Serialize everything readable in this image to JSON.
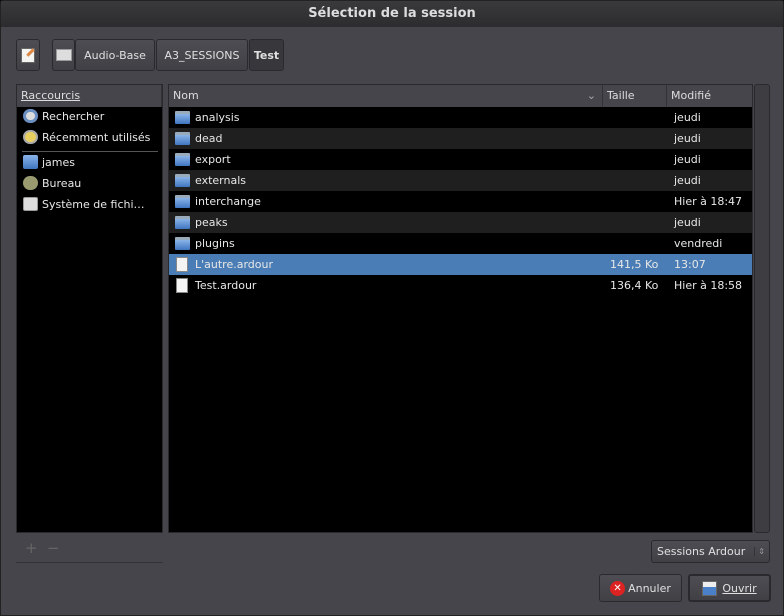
{
  "title": "Sélection de la session",
  "toolbar": {
    "path": [
      "Audio-Base",
      "A3_SESSIONS",
      "Test"
    ]
  },
  "sidebar": {
    "header": "Raccourcis",
    "items": [
      {
        "label": "Rechercher",
        "icon": "search-icon"
      },
      {
        "label": "Récemment utilisés",
        "icon": "clock-icon"
      },
      {
        "label": "james",
        "icon": "home-folder-icon"
      },
      {
        "label": "Bureau",
        "icon": "desktop-icon"
      },
      {
        "label": "Système de fichi…",
        "icon": "drive-icon"
      }
    ],
    "add": "+",
    "remove": "−"
  },
  "files": {
    "columns": [
      "Nom",
      "Taille",
      "Modifié"
    ],
    "rows": [
      {
        "name": "analysis",
        "size": "",
        "modified": "jeudi",
        "type": "folder"
      },
      {
        "name": "dead",
        "size": "",
        "modified": "jeudi",
        "type": "folder"
      },
      {
        "name": "export",
        "size": "",
        "modified": "jeudi",
        "type": "folder"
      },
      {
        "name": "externals",
        "size": "",
        "modified": "jeudi",
        "type": "folder"
      },
      {
        "name": "interchange",
        "size": "",
        "modified": "Hier à 18:47",
        "type": "folder"
      },
      {
        "name": "peaks",
        "size": "",
        "modified": "jeudi",
        "type": "folder"
      },
      {
        "name": "plugins",
        "size": "",
        "modified": "vendredi",
        "type": "folder"
      },
      {
        "name": "L'autre.ardour",
        "size": "141,5 Ko",
        "modified": "13:07",
        "type": "file",
        "selected": true
      },
      {
        "name": "Test.ardour",
        "size": "136,4 Ko",
        "modified": "Hier à 18:58",
        "type": "file"
      }
    ]
  },
  "filter": "Sessions Ardour",
  "buttons": {
    "cancel": "Annuler",
    "open": "Ouvrir"
  },
  "colors": {
    "selected": "#4a7db5"
  }
}
